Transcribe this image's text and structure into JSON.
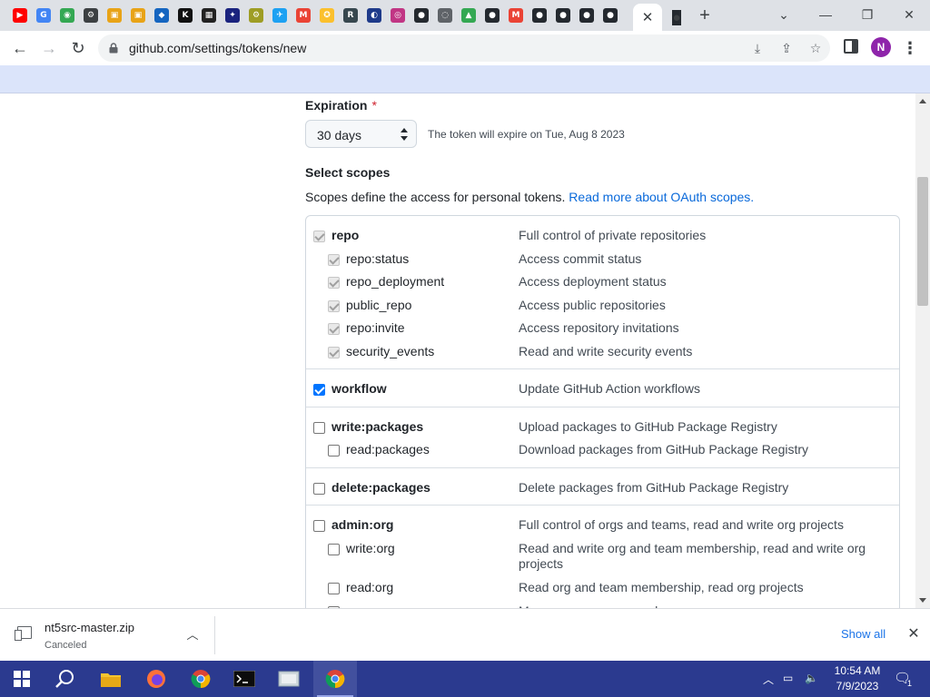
{
  "browser": {
    "url": "github.com/settings/tokens/new",
    "profile_initial": "N",
    "active_tab_close": "✕",
    "new_tab": "+",
    "tab_favicons": [
      {
        "icon": "youtube-icon",
        "color": "#ff0000",
        "glyph": "▶"
      },
      {
        "icon": "google-icon",
        "color": "#4285f4",
        "glyph": "G"
      },
      {
        "icon": "green-circle-icon",
        "color": "#34a853",
        "glyph": "◉"
      },
      {
        "icon": "gear-icon",
        "color": "#3c4043",
        "glyph": "⚙"
      },
      {
        "icon": "folder-icon",
        "color": "#e8a317",
        "glyph": "▣"
      },
      {
        "icon": "folder-icon",
        "color": "#e8a317",
        "glyph": "▣"
      },
      {
        "icon": "blue-square-icon",
        "color": "#1565c0",
        "glyph": "◆"
      },
      {
        "icon": "kim-icon",
        "color": "#111111",
        "glyph": "K"
      },
      {
        "icon": "qr-icon",
        "color": "#222222",
        "glyph": "▦"
      },
      {
        "icon": "dark-blue-icon",
        "color": "#1a237e",
        "glyph": "✦"
      },
      {
        "icon": "yellow-gear-icon",
        "color": "#9e9d24",
        "glyph": "⚙"
      },
      {
        "icon": "twitter-icon",
        "color": "#1da1f2",
        "glyph": "✈"
      },
      {
        "icon": "gmail-icon",
        "color": "#ea4335",
        "glyph": "M"
      },
      {
        "icon": "bulb-icon",
        "color": "#fbc02d",
        "glyph": "✪"
      },
      {
        "icon": "ri-icon",
        "color": "#37474f",
        "glyph": "R"
      },
      {
        "icon": "blue-logo-icon",
        "color": "#1e3a8a",
        "glyph": "◐"
      },
      {
        "icon": "instagram-icon",
        "color": "#c13584",
        "glyph": "◎"
      },
      {
        "icon": "github-icon",
        "color": "#24292f",
        "glyph": "●"
      },
      {
        "icon": "chrome-gray-icon",
        "color": "#5f6368",
        "glyph": "◌"
      },
      {
        "icon": "drive-icon",
        "color": "#34a853",
        "glyph": "▲"
      },
      {
        "icon": "github-icon",
        "color": "#24292f",
        "glyph": "●"
      },
      {
        "icon": "gmail-icon",
        "color": "#ea4335",
        "glyph": "M"
      },
      {
        "icon": "github-icon",
        "color": "#24292f",
        "glyph": "●"
      },
      {
        "icon": "github-icon",
        "color": "#24292f",
        "glyph": "●"
      },
      {
        "icon": "github-icon",
        "color": "#24292f",
        "glyph": "●"
      },
      {
        "icon": "github-icon",
        "color": "#24292f",
        "glyph": "●"
      }
    ],
    "after_active_tab_icon": {
      "icon": "github-icon",
      "color": "#24292f",
      "glyph": "●"
    }
  },
  "form": {
    "expiration_label": "Expiration",
    "required_mark": "*",
    "expiration_value": "30 days",
    "expiration_hint": "The token will expire on Tue, Aug 8 2023",
    "scopes_label": "Select scopes",
    "scopes_desc": "Scopes define the access for personal tokens.",
    "scopes_link": "Read more about OAuth scopes."
  },
  "scopes": [
    {
      "name": "repo",
      "desc": "Full control of private repositories",
      "parent": true,
      "state": "disabled"
    },
    {
      "name": "repo:status",
      "desc": "Access commit status",
      "parent": false,
      "state": "disabled"
    },
    {
      "name": "repo_deployment",
      "desc": "Access deployment status",
      "parent": false,
      "state": "disabled"
    },
    {
      "name": "public_repo",
      "desc": "Access public repositories",
      "parent": false,
      "state": "disabled"
    },
    {
      "name": "repo:invite",
      "desc": "Access repository invitations",
      "parent": false,
      "state": "disabled"
    },
    {
      "name": "security_events",
      "desc": "Read and write security events",
      "parent": false,
      "state": "disabled"
    },
    {
      "name": "workflow",
      "desc": "Update GitHub Action workflows",
      "parent": true,
      "state": "checked"
    },
    {
      "name": "write:packages",
      "desc": "Upload packages to GitHub Package Registry",
      "parent": true,
      "state": "unchecked"
    },
    {
      "name": "read:packages",
      "desc": "Download packages from GitHub Package Registry",
      "parent": false,
      "state": "unchecked"
    },
    {
      "name": "delete:packages",
      "desc": "Delete packages from GitHub Package Registry",
      "parent": true,
      "state": "unchecked"
    },
    {
      "name": "admin:org",
      "desc": "Full control of orgs and teams, read and write org projects",
      "parent": true,
      "state": "unchecked"
    },
    {
      "name": "write:org",
      "desc": "Read and write org and team membership, read and write org projects",
      "parent": false,
      "state": "unchecked"
    },
    {
      "name": "read:org",
      "desc": "Read org and team membership, read org projects",
      "parent": false,
      "state": "unchecked"
    },
    {
      "name": "manage_runners:org",
      "desc": "Manage org runners and runner groups",
      "parent": false,
      "state": "unchecked"
    }
  ],
  "download": {
    "filename": "nt5src-master.zip",
    "status": "Canceled",
    "show_all": "Show all"
  },
  "taskbar": {
    "time": "10:54 AM",
    "date": "7/9/2023",
    "notification_count": "1"
  }
}
